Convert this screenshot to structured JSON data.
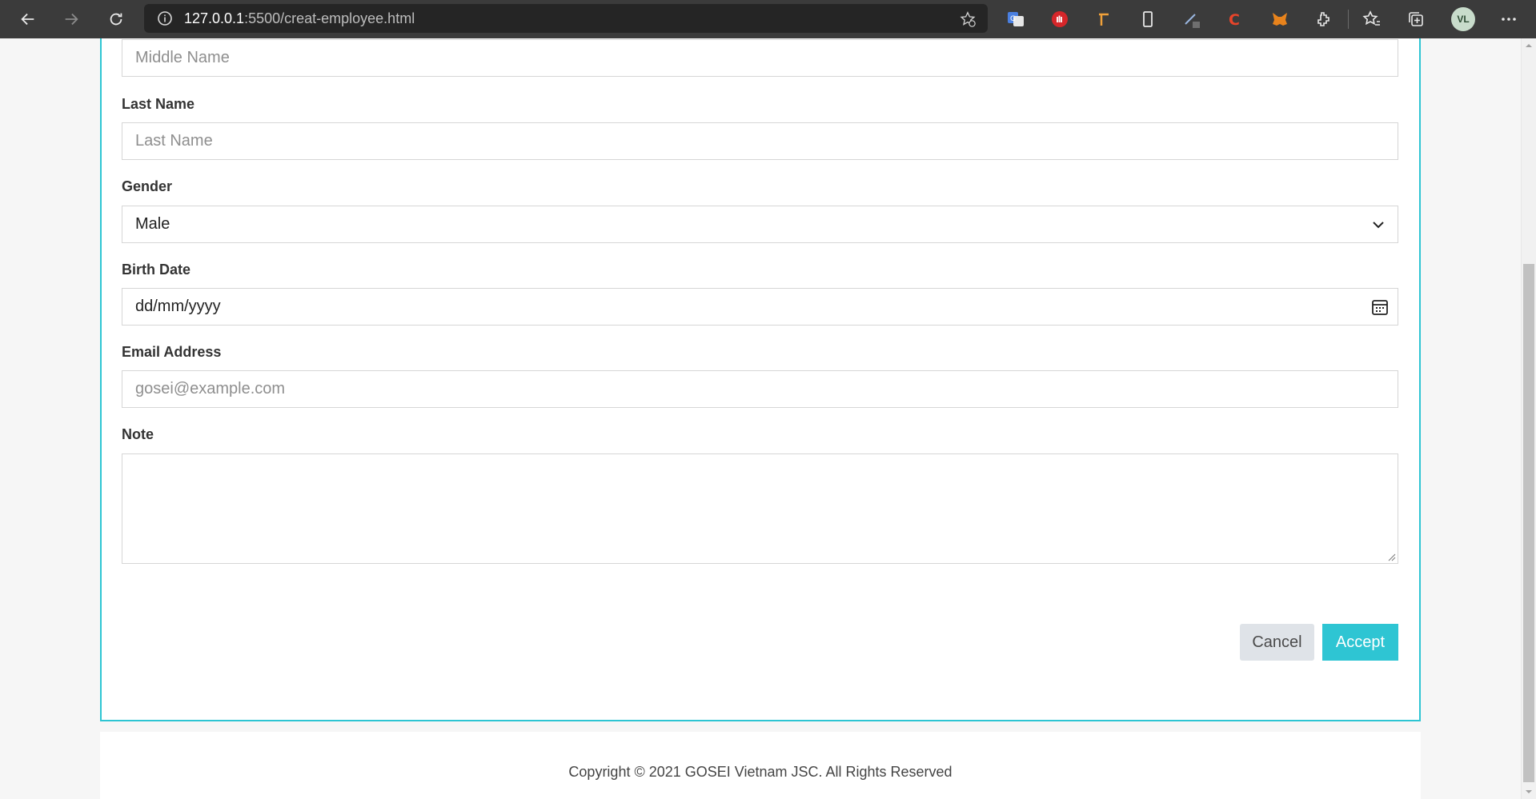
{
  "browser": {
    "url_host": "127.0.0.1",
    "url_rest": ":5500/creat-employee.html",
    "avatar_initials": "VL"
  },
  "form": {
    "middle_name_placeholder": "Middle Name",
    "last_name_label": "Last Name",
    "last_name_placeholder": "Last Name",
    "gender_label": "Gender",
    "gender_value": "Male",
    "birth_date_label": "Birth Date",
    "birth_date_value": "dd/mm/yyyy",
    "email_label": "Email Address",
    "email_placeholder": "gosei@example.com",
    "note_label": "Note",
    "note_value": "",
    "cancel_label": "Cancel",
    "accept_label": "Accept"
  },
  "footer": {
    "copyright": "Copyright © 2021 GOSEI Vietnam JSC. All Rights Reserved"
  },
  "colors": {
    "accent": "#2ec5d3",
    "chrome": "#3b3b3b"
  }
}
